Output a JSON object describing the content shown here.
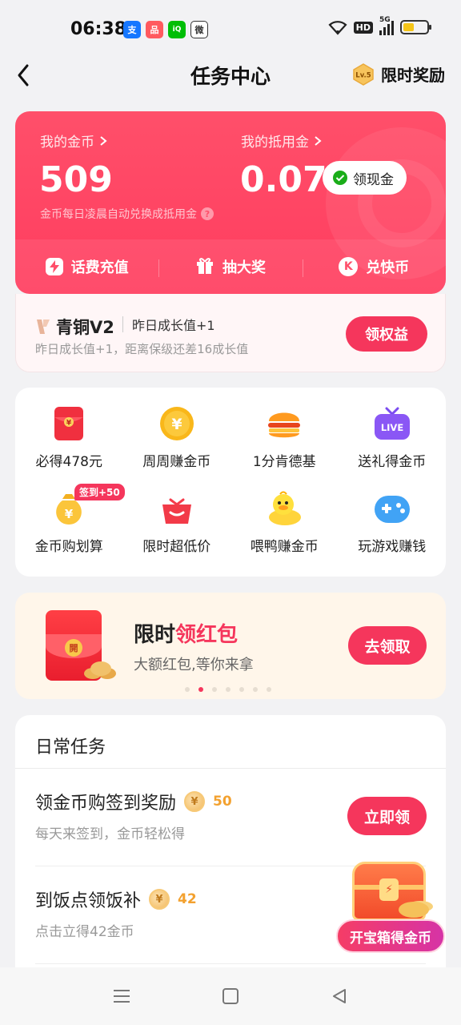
{
  "status_bar": {
    "time": "06:38",
    "apps": [
      {
        "icon": "alipay-icon",
        "glyph": "支",
        "color": "#1677ff"
      },
      {
        "icon": "app-icon",
        "glyph": "品",
        "color": "#ff5a5f"
      },
      {
        "icon": "iqiyi-icon",
        "glyph": "iQ",
        "color": "#00be06"
      },
      {
        "icon": "wechat-icon",
        "glyph": "微",
        "color": "#333333"
      }
    ],
    "network": "HD",
    "signal_label": "5G",
    "battery_level": 0.45
  },
  "header": {
    "title": "任务中心",
    "level_badge": "Lv.5",
    "reward_label": "限时奖励"
  },
  "wallet": {
    "coins_label": "我的金币",
    "coins_value": "509",
    "credit_label": "我的抵用金",
    "credit_value": "0.07",
    "cash_button": "领现金",
    "note": "金币每日凌晨自动兑换成抵用金",
    "actions": [
      {
        "label": "话费充值",
        "icon": "lightning-icon"
      },
      {
        "label": "抽大奖",
        "icon": "gift-icon"
      },
      {
        "label": "兑快币",
        "icon": "k-coin-icon"
      }
    ]
  },
  "level": {
    "name": "青铜V2",
    "growth": "昨日成长值+1",
    "desc": "昨日成长值+1，距离保级还差16成长值",
    "button": "领权益"
  },
  "grid": [
    {
      "label": "必得478元",
      "icon": "red-envelope-icon"
    },
    {
      "label": "周周赚金币",
      "icon": "yuan-coin-icon"
    },
    {
      "label": "1分肯德基",
      "icon": "burger-icon"
    },
    {
      "label": "送礼得金币",
      "icon": "live-tv-icon",
      "icon_text": "LIVE"
    },
    {
      "label": "金币购划算",
      "icon": "money-bag-icon",
      "badge": "签到+50"
    },
    {
      "label": "限时超低价",
      "icon": "shopping-basket-icon"
    },
    {
      "label": "喂鸭赚金币",
      "icon": "duck-icon"
    },
    {
      "label": "玩游戏赚钱",
      "icon": "gamepad-icon"
    }
  ],
  "banner": {
    "title_prefix": "限时",
    "title_highlight": "领红包",
    "subtitle": "大额红包,等你来拿",
    "button": "去领取",
    "seal": "開",
    "dots": 7,
    "active_dot": 1
  },
  "daily": {
    "title": "日常任务",
    "tasks": [
      {
        "title": "领金币购签到奖励",
        "reward": "50",
        "desc": "每天来签到，金币轻松得",
        "button": "立即领"
      },
      {
        "title": "到饭点领饭补",
        "reward": "42",
        "desc": "点击立得42金币"
      }
    ]
  },
  "chest": {
    "label": "开宝箱得金币"
  },
  "colors": {
    "accent": "#f5365c",
    "wallet_bg": "#ff4f6a",
    "coin": "#f3a12f"
  }
}
